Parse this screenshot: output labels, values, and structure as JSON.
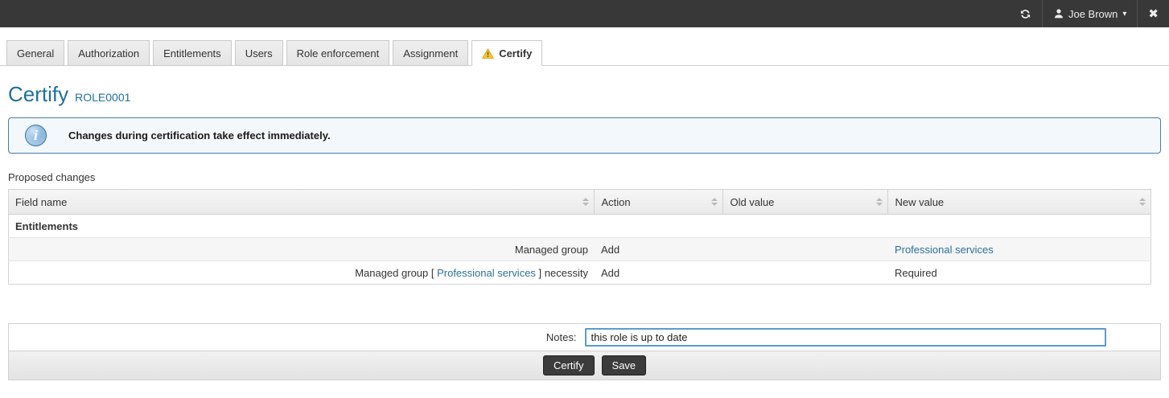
{
  "topbar": {
    "user_label": "Joe Brown",
    "caret_glyph": "▾",
    "close_glyph": "✖"
  },
  "tabs": [
    {
      "label": "General"
    },
    {
      "label": "Authorization"
    },
    {
      "label": "Entitlements"
    },
    {
      "label": "Users"
    },
    {
      "label": "Role enforcement"
    },
    {
      "label": "Assignment"
    },
    {
      "label": "Certify"
    }
  ],
  "page": {
    "title": "Certify",
    "subtitle": "ROLE0001"
  },
  "alert": {
    "icon_glyph": "i",
    "text": "Changes during certification take effect immediately."
  },
  "table": {
    "caption": "Proposed changes",
    "columns": [
      "Field name",
      "Action",
      "Old value",
      "New value"
    ],
    "group_label": "Entitlements",
    "rows": [
      {
        "field": "Managed group",
        "action": "Add",
        "old": "",
        "new_link": "Professional services"
      },
      {
        "field_prefix": "Managed group [ ",
        "field_link": "Professional services",
        "field_suffix": " ] necessity",
        "action": "Add",
        "old": "",
        "new": "Required"
      }
    ]
  },
  "form": {
    "notes_label": "Notes:",
    "notes_value": "this role is up to date",
    "certify_label": "Certify",
    "save_label": "Save"
  },
  "colors": {
    "topbar_bg": "#383838",
    "title_accent": "#1f6f9f",
    "link": "#2a7199",
    "alert_border": "#4a7ba6",
    "warning_yellow": "#f8c533",
    "button_dark": "#3b3b3b"
  }
}
